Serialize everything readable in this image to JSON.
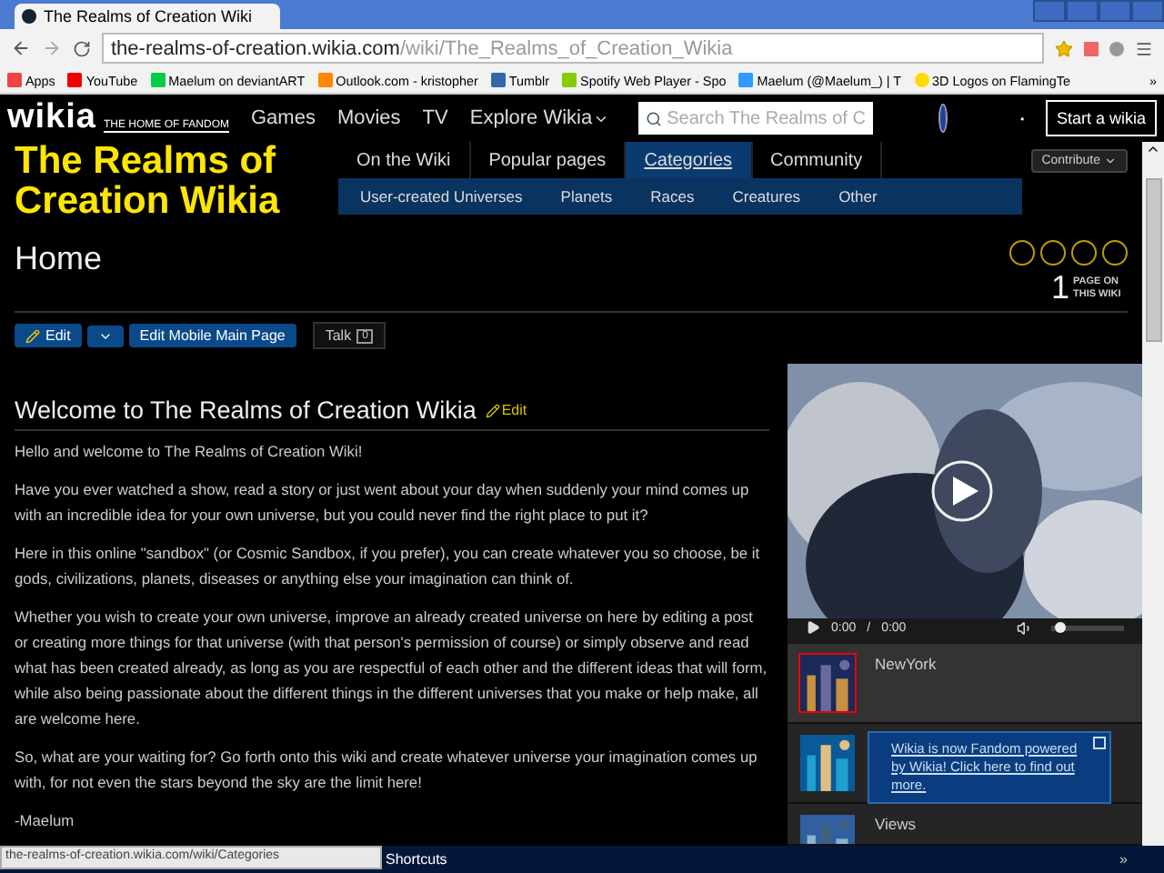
{
  "browser": {
    "tab_title": "The Realms of Creation Wiki",
    "url_host": "the-realms-of-creation.wikia.com",
    "url_path": "/wiki/The_Realms_of_Creation_Wikia",
    "bookmarks": [
      "Apps",
      "YouTube",
      "Maelum on deviantART",
      "Outlook.com - kristopher",
      "Tumblr",
      "Spotify Web Player - Spo",
      "Maelum (@Maelum_) | T",
      "3D Logos on FlamingTe"
    ],
    "more": "»"
  },
  "topbar": {
    "logo": "wikia",
    "tagline": "THE HOME OF FANDOM",
    "links": [
      "Games",
      "Movies",
      "TV"
    ],
    "explore": "Explore Wikia",
    "search_placeholder": "Search The Realms of C",
    "start": "Start a wikia"
  },
  "wiki": {
    "name": "The Realms of Creation Wikia",
    "contribute": "Contribute",
    "tabs": [
      {
        "label": "On the Wiki",
        "selected": false
      },
      {
        "label": "Popular pages",
        "selected": false
      },
      {
        "label": "Categories",
        "selected": true
      },
      {
        "label": "Community",
        "selected": false
      }
    ],
    "subnav": [
      "User-created Universes",
      "Planets",
      "Races",
      "Creatures",
      "Other"
    ]
  },
  "page": {
    "title": "Home",
    "page_count": "1",
    "page_count_label": "PAGE ON THIS WIKI",
    "edit": "Edit",
    "edit_mobile": "Edit Mobile Main Page",
    "talk": "Talk",
    "talk_count": "0",
    "heading": "Welcome to The Realms of Creation Wikia",
    "heading_edit": "Edit",
    "paragraphs": [
      "Hello and welcome to The Realms of Creation Wiki!",
      "Have you ever watched a show, read a story or just went about your day when suddenly your mind comes up with an incredible idea for your own universe, but you could never find the right place to put it?",
      "Here in this online \"sandbox\" (or Cosmic Sandbox, if you prefer), you can create whatever you so choose, be it gods, civilizations, planets, diseases or anything else your imagination can think of.",
      "Whether you wish to create your own universe, improve an already created universe on here by editing a post or creating more things for that universe (with that person's permission of course) or simply observe and read what has been created already, as long as you are respectful of each other and the different ideas that will form, while also being passionate about the different things in the different universes that you make or help make, all are welcome here.",
      "So, what are your waiting for? Go forth onto this wiki and create whatever universe your imagination comes up with, for not even the stars beyond the sky are the limit here!",
      "-Maelum"
    ]
  },
  "video": {
    "time": "0:00",
    "separator": "/",
    "duration": "0:00",
    "volume": {
      "level": 0.06
    },
    "playlist": [
      {
        "title": "NewYork",
        "selected": true,
        "kind": "city"
      },
      {
        "selected": false,
        "kind": "sea"
      },
      {
        "title": "Views",
        "selected": false,
        "kind": "sky"
      }
    ]
  },
  "notification": "Wikia is now Fandom powered by Wikia! Click here to find out more.",
  "status_url": "the-realms-of-creation.wikia.com/wiki/Categories",
  "toolbar": {
    "shortcuts": "Shortcuts",
    "expand": "»"
  }
}
